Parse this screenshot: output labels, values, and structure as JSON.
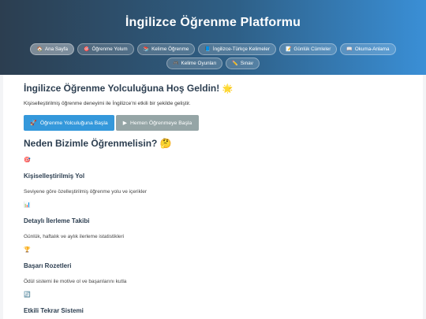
{
  "header": {
    "title": "İngilizce Öğrenme Platformu"
  },
  "nav": {
    "items": [
      {
        "icon": "home-icon",
        "glyph": "🏠",
        "label": "Ana Sayfa",
        "active": true
      },
      {
        "icon": "target-icon",
        "glyph": "🎯",
        "label": "Öğrenme Yolum"
      },
      {
        "icon": "books-icon",
        "glyph": "📚",
        "label": "Kelime Öğrenme"
      },
      {
        "icon": "dictionary-icon",
        "glyph": "📘",
        "label": "İngilizce-Türkçe Kelimeler"
      },
      {
        "icon": "notes-icon",
        "glyph": "📝",
        "label": "Günlük Cümleler"
      },
      {
        "icon": "book-icon",
        "glyph": "📖",
        "label": "Okuma-Anlama"
      },
      {
        "icon": "game-icon",
        "glyph": "🎮",
        "label": "Kelime Oyunları"
      },
      {
        "icon": "pencil-icon",
        "glyph": "✏️",
        "label": "Sınav"
      }
    ]
  },
  "welcome": {
    "title": "İngilizce Öğrenme Yolculuğuna Hoş Geldin!",
    "title_emoji": "🌟",
    "intro": "Kişiselleştirilmiş öğrenme deneyimi ile İngilizce'ni etkili bir şekilde geliştir.",
    "start_button": {
      "glyph": "🚀",
      "label": "Öğrenme Yolculuğuna Başla"
    },
    "quick_button": {
      "glyph": "▶",
      "label": "Hemen Öğrenmeye Başla"
    }
  },
  "why": {
    "title": "Neden Bizimle Öğrenmelisin?",
    "title_emoji": "🤔"
  },
  "features": [
    {
      "icon": "target-icon",
      "glyph": "🎯",
      "title": "Kişiselleştirilmiş Yol",
      "desc": "Seviyene göre özelleştirilmiş öğrenme yolu ve içerikler"
    },
    {
      "icon": "chart-icon",
      "glyph": "📊",
      "title": "Detaylı İlerleme Takibi",
      "desc": "Günlük, haftalık ve aylık ilerleme istatistikleri"
    },
    {
      "icon": "trophy-icon",
      "glyph": "🏆",
      "title": "Başarı Rozetleri",
      "desc": "Ödül sistemi ile motive ol ve başarılarını kutla"
    },
    {
      "icon": "repeat-icon",
      "glyph": "🔄",
      "title": "Etkili Tekrar Sistemi",
      "desc": ""
    }
  ],
  "colors": {
    "header_start": "#2c3e50",
    "header_end": "#3a8fd6",
    "primary": "#3498db",
    "secondary": "#95a5a6",
    "text_dark": "#2c3e50"
  }
}
